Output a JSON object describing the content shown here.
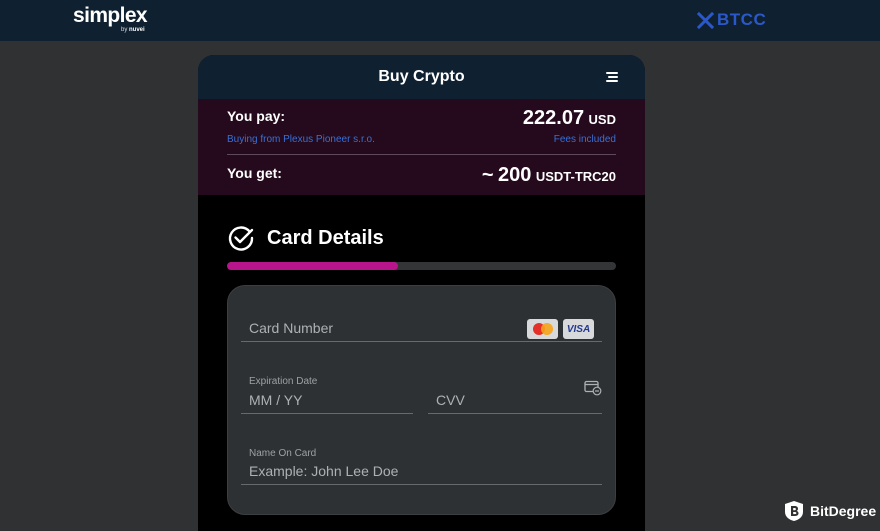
{
  "topbar": {
    "brand_name": "simplex",
    "brand_by": "by",
    "brand_company": "nuvei",
    "partner_name": "BTCC"
  },
  "widget": {
    "title": "Buy Crypto"
  },
  "summary": {
    "pay_label": "You pay:",
    "pay_amount": "222.07",
    "pay_currency": "USD",
    "merchant_text": "Buying from Plexus Pioneer s.r.o.",
    "fees_text": "Fees included",
    "get_label": "You get:",
    "get_approx": "~",
    "get_amount": "200",
    "get_currency": "USDT-TRC20"
  },
  "section": {
    "title": "Card Details",
    "progress": 0.44
  },
  "form": {
    "card_number_placeholder": "Card Number",
    "card_brands": [
      "Mastercard",
      "VISA"
    ],
    "visa_label": "VISA",
    "expiration_label": "Expiration Date",
    "expiration_placeholder": "MM / YY",
    "cvv_placeholder": "CVV",
    "name_label": "Name On Card",
    "name_placeholder": "Example: John Lee Doe"
  },
  "watermark": {
    "name": "BitDegree"
  },
  "colors": {
    "header_bg": "#0f2131",
    "summary_bg": "#240a1c",
    "accent_progress": "#b8158c",
    "link_blue": "#3a6fd6",
    "partner_blue": "#2b58c8"
  },
  "icons": {
    "menu": "hamburger-menu-icon",
    "section": "check-circle-icon",
    "cvv": "card-cvv-icon",
    "partner": "btcc-logo-icon",
    "watermark": "bitdegree-logo-icon"
  }
}
